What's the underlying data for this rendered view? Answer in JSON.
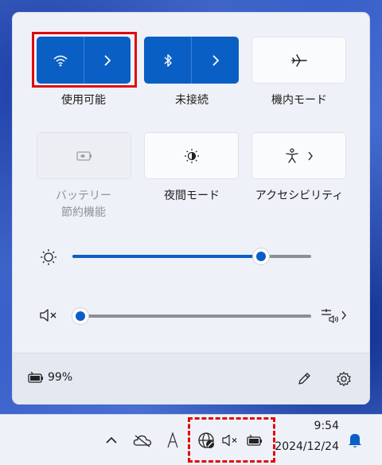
{
  "quick_settings": {
    "wifi": {
      "label": "使用可能",
      "state": "on"
    },
    "bluetooth": {
      "label": "未接続",
      "state": "on"
    },
    "airplane": {
      "label": "機内モード",
      "state": "off"
    },
    "battery_saver": {
      "label_line1": "バッテリー",
      "label_line2": "節約機能",
      "state": "disabled"
    },
    "night_light": {
      "label": "夜間モード",
      "state": "off"
    },
    "accessibility": {
      "label": "アクセシビリティ",
      "state": "off"
    }
  },
  "brightness": {
    "level": 0.79
  },
  "volume": {
    "level": 0.0,
    "muted": true
  },
  "footer": {
    "battery_percent": "99%"
  },
  "taskbar": {
    "time": "9:54",
    "date": "2024/12/24"
  },
  "colors": {
    "accent": "#0a5fc4",
    "highlight": "#e20a0a"
  },
  "icons": [
    "wifi-icon",
    "chevron-right-icon",
    "bluetooth-icon",
    "airplane-icon",
    "battery-saver-icon",
    "night-light-icon",
    "accessibility-icon",
    "brightness-icon",
    "volume-muted-icon",
    "audio-output-icon",
    "battery-icon",
    "pencil-icon",
    "gear-icon",
    "chevron-up-icon",
    "onedrive-icon",
    "ime-icon",
    "network-icon",
    "bell-icon"
  ]
}
